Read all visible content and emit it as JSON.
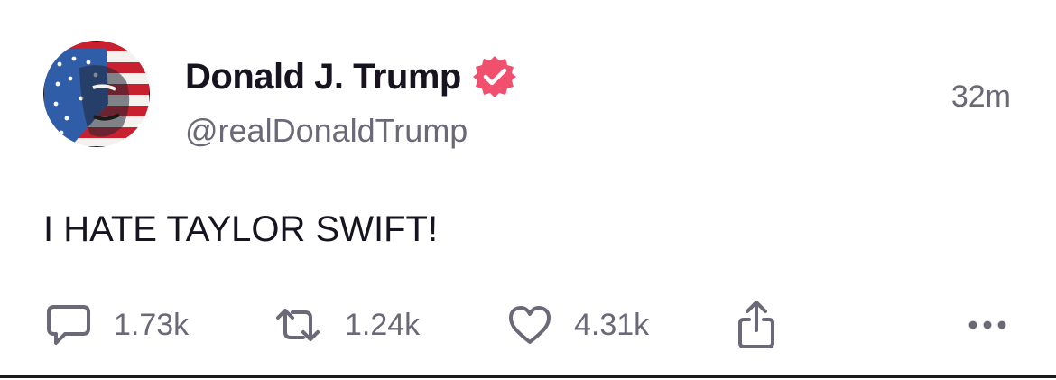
{
  "author": {
    "display_name": "Donald J. Trump",
    "handle": "@realDonaldTrump",
    "verified": true,
    "verified_color": "#f0506e"
  },
  "post": {
    "timestamp": "32m",
    "text": "I HATE TAYLOR SWIFT!"
  },
  "actions": {
    "replies": "1.73k",
    "reposts": "1.24k",
    "likes": "4.31k"
  },
  "icons": {
    "reply": "speech-bubble-icon",
    "repost": "repost-arrows-icon",
    "like": "heart-icon",
    "share": "share-icon",
    "more": "ellipsis-icon",
    "verified": "verified-badge-icon"
  },
  "colors": {
    "text_primary": "#17141f",
    "text_secondary": "#6b6877",
    "background": "#ffffff"
  }
}
